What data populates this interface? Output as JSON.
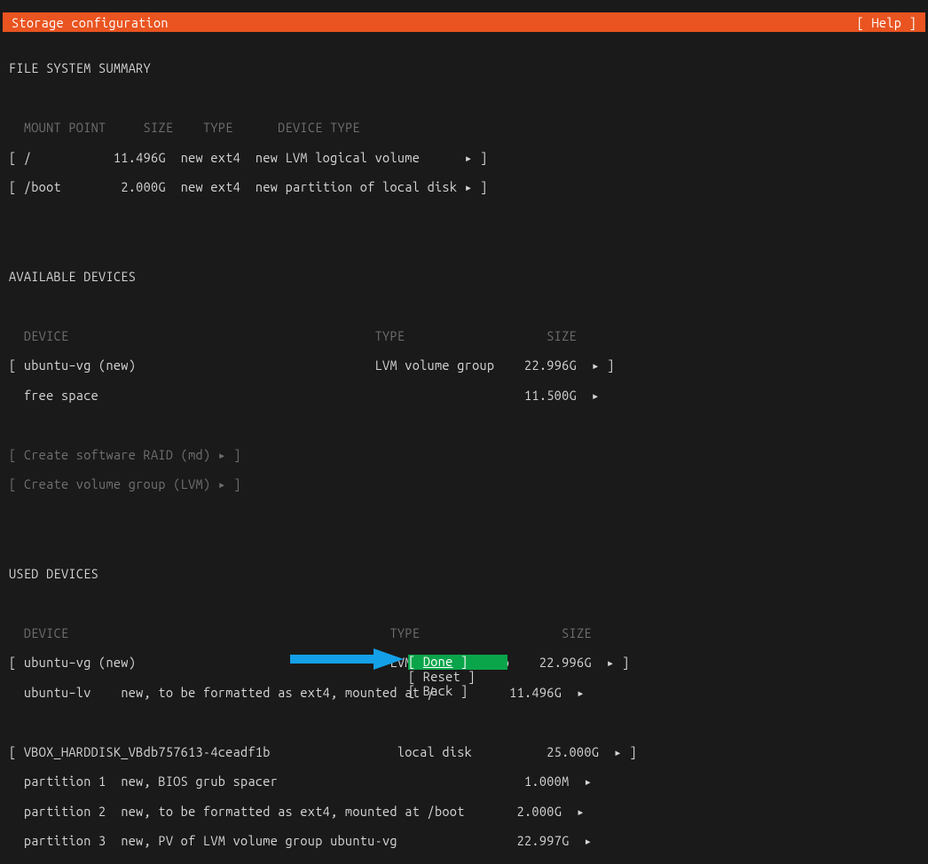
{
  "header": {
    "title": "Storage configuration",
    "help_label": "[ Help ]"
  },
  "sections": {
    "fs_summary_title": "FILE SYSTEM SUMMARY",
    "fs_headers": {
      "mount": "MOUNT POINT",
      "size": "SIZE",
      "type": "TYPE",
      "devtype": "DEVICE TYPE"
    },
    "fs_rows": [
      {
        "mount": "/",
        "size": "11.496G",
        "type": "new ext4",
        "devtype": "new LVM logical volume"
      },
      {
        "mount": "/boot",
        "size": "2.000G",
        "type": "new ext4",
        "devtype": "new partition of local disk"
      }
    ],
    "avail_title": "AVAILABLE DEVICES",
    "avail_headers": {
      "device": "DEVICE",
      "type": "TYPE",
      "size": "SIZE"
    },
    "avail_rows": [
      {
        "device": "ubuntu–vg (new)",
        "type": "LVM volume group",
        "size": "22.996G"
      },
      {
        "device": "free space",
        "type": "",
        "size": "11.500G"
      }
    ],
    "create_raid": "[ Create software RAID (md) ▸ ]",
    "create_lvm": "[ Create volume group (LVM) ▸ ]",
    "used_title": "USED DEVICES",
    "used_headers": {
      "device": "DEVICE",
      "type": "TYPE",
      "size": "SIZE"
    },
    "used_group1": {
      "head": {
        "device": "ubuntu–vg (new)",
        "type": "LVM volume group",
        "size": "22.996G"
      },
      "rows": [
        {
          "name": "ubuntu–lv",
          "desc": "new, to be formatted as ext4, mounted at /",
          "size": "11.496G"
        }
      ]
    },
    "used_group2": {
      "head": {
        "device": "VBOX_HARDDISK_VBdb757613-4ceadf1b",
        "type": "local disk",
        "size": "25.000G"
      },
      "rows": [
        {
          "name": "partition 1",
          "desc": "new, BIOS grub spacer",
          "size": "1.000M"
        },
        {
          "name": "partition 2",
          "desc": "new, to be formatted as ext4, mounted at /boot",
          "size": "2.000G"
        },
        {
          "name": "partition 3",
          "desc": "new, PV of LVM volume group ubuntu-vg",
          "size": "22.997G"
        }
      ]
    }
  },
  "buttons": {
    "done": "Done",
    "reset": "Reset",
    "back": "Back"
  },
  "annotation": {
    "arrow_color": "#14a0e8"
  }
}
